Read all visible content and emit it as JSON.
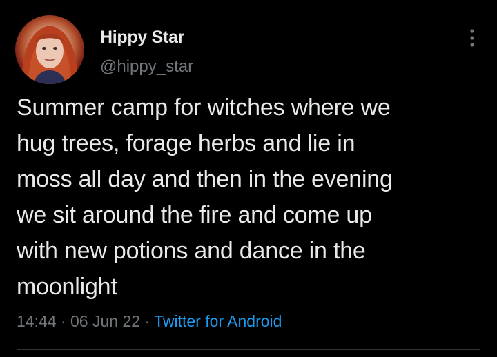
{
  "author": {
    "display_name": "Hippy Star",
    "handle": "@hippy_star",
    "avatar_icon": "profile-photo"
  },
  "tweet": {
    "text": "Summer camp for witches where we\nhug trees, forage herbs and lie in\nmoss all day and then in the evening\nwe sit around the fire and come up\nwith new potions and dance in the\nmoonlight"
  },
  "meta": {
    "time": "14:44",
    "separator": "·",
    "date": "06 Jun 22",
    "source": "Twitter for Android"
  },
  "colors": {
    "background": "#000000",
    "text": "#e7e9ea",
    "muted": "#71767b",
    "link": "#1d9bf0"
  },
  "icons": {
    "more": "more-vertical-icon"
  }
}
